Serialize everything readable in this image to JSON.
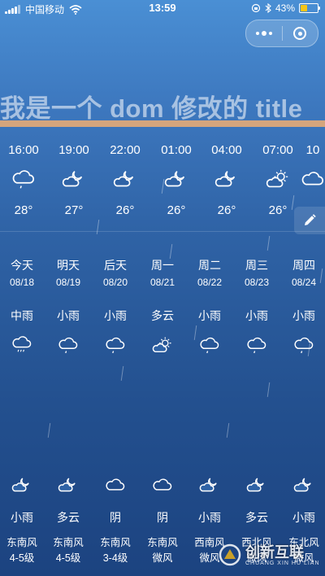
{
  "status_bar": {
    "carrier": "中国移动",
    "time": "13:59",
    "battery_text": "43%",
    "battery_level": 0.43,
    "battery_color": "#f5c518"
  },
  "page_title": "我是一个 dom 修改的 title",
  "hourly": [
    {
      "time": "16:00",
      "icon": "cloud-rain-icon",
      "temp": "28°"
    },
    {
      "time": "19:00",
      "icon": "moon-cloud-icon",
      "temp": "27°"
    },
    {
      "time": "22:00",
      "icon": "moon-cloud-icon",
      "temp": "26°"
    },
    {
      "time": "01:00",
      "icon": "moon-cloud-icon",
      "temp": "26°"
    },
    {
      "time": "04:00",
      "icon": "moon-cloud-icon",
      "temp": "26°"
    },
    {
      "time": "07:00",
      "icon": "sun-cloud-icon",
      "temp": "26°"
    },
    {
      "time": "10",
      "icon": "cloud-icon",
      "temp": ""
    }
  ],
  "daily": [
    {
      "name": "今天",
      "date": "08/18",
      "cond": "中雨",
      "icon": "cloud-heavy-rain-icon"
    },
    {
      "name": "明天",
      "date": "08/19",
      "cond": "小雨",
      "icon": "cloud-rain-icon"
    },
    {
      "name": "后天",
      "date": "08/20",
      "cond": "小雨",
      "icon": "cloud-rain-icon"
    },
    {
      "name": "周一",
      "date": "08/21",
      "cond": "多云",
      "icon": "sun-cloud-icon"
    },
    {
      "name": "周二",
      "date": "08/22",
      "cond": "小雨",
      "icon": "cloud-rain-icon"
    },
    {
      "name": "周三",
      "date": "08/23",
      "cond": "小雨",
      "icon": "cloud-rain-icon"
    },
    {
      "name": "周四",
      "date": "08/24",
      "cond": "小雨",
      "icon": "cloud-rain-icon"
    }
  ],
  "nightly": [
    {
      "cond": "小雨",
      "icon": "moon-cloud-icon",
      "wind_dir": "东南风",
      "wind_level": "4-5级"
    },
    {
      "cond": "多云",
      "icon": "moon-cloud-icon",
      "wind_dir": "东南风",
      "wind_level": "4-5级"
    },
    {
      "cond": "阴",
      "icon": "cloud-icon",
      "wind_dir": "东南风",
      "wind_level": "3-4级"
    },
    {
      "cond": "阴",
      "icon": "cloud-icon",
      "wind_dir": "东南风",
      "wind_level": "微风"
    },
    {
      "cond": "小雨",
      "icon": "moon-cloud-icon",
      "wind_dir": "西南风",
      "wind_level": "微风"
    },
    {
      "cond": "多云",
      "icon": "moon-cloud-icon",
      "wind_dir": "西北风",
      "wind_level": "微风"
    },
    {
      "cond": "小雨",
      "icon": "moon-cloud-icon",
      "wind_dir": "东北风",
      "wind_level": "微风"
    }
  ],
  "watermark": {
    "brand": "创新互联",
    "sub": "CHUANG XIN HU LIAN"
  }
}
